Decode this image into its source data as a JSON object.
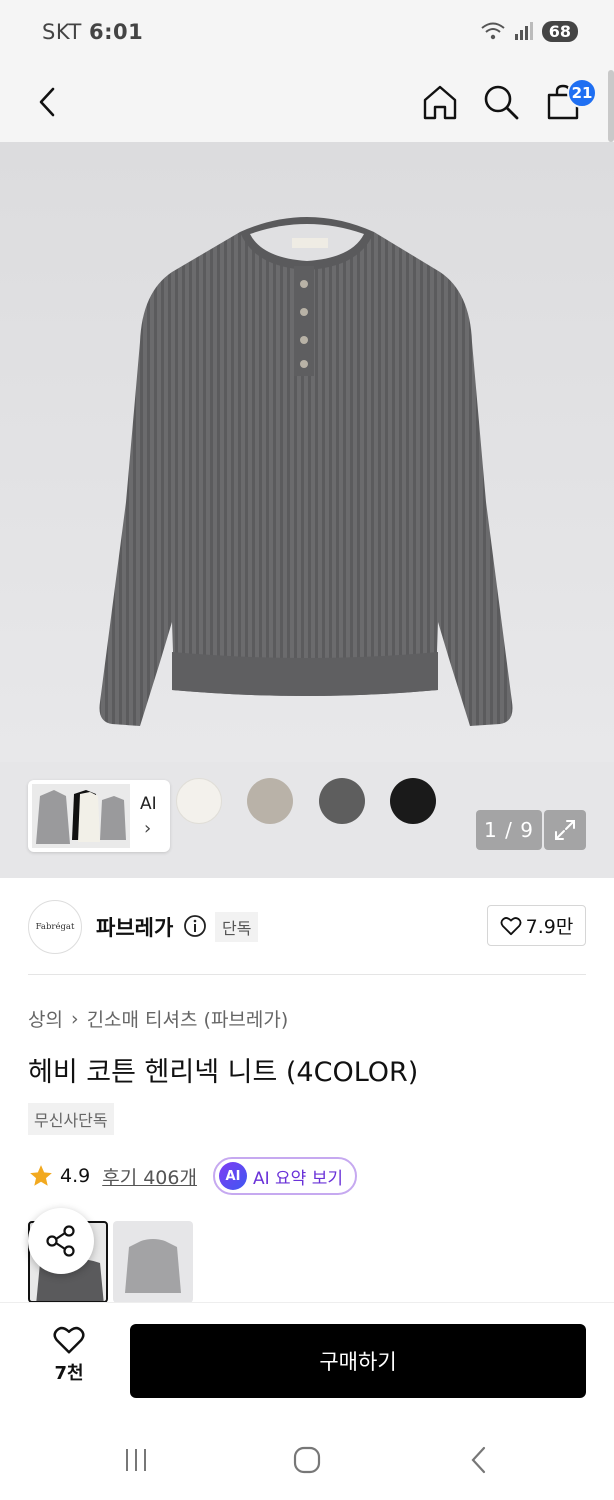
{
  "status_bar": {
    "carrier": "SKT",
    "time": "6:01",
    "battery": "68"
  },
  "header": {
    "cart_count": "21"
  },
  "hero": {
    "ai_label": "AI",
    "page_counter": "1 / 9",
    "swatch_colors": [
      "#f3f1ec",
      "#b9b2a8",
      "#5e5e5e",
      "#1a1a1a"
    ]
  },
  "brand": {
    "logo_text": "Fabrégat",
    "name": "파브레가",
    "tag": "단독",
    "likes": "7.9만"
  },
  "product": {
    "breadcrumb": [
      "상의",
      "긴소매 티셔츠 (파브레가)"
    ],
    "title": "헤비 코튼 헨리넥 니트 (4COLOR)",
    "exclusive_badge": "무신사단독",
    "rating": "4.9",
    "reviews": "후기 406개",
    "ai_badge": "AI",
    "ai_summary": "AI 요약 보기"
  },
  "bottom_bar": {
    "wish_count": "7천",
    "buy_label": "구매하기"
  },
  "colors": {
    "accent_blue": "#1f6ff2",
    "ai_purple": "#6a32d8",
    "star": "#f2a91f"
  }
}
